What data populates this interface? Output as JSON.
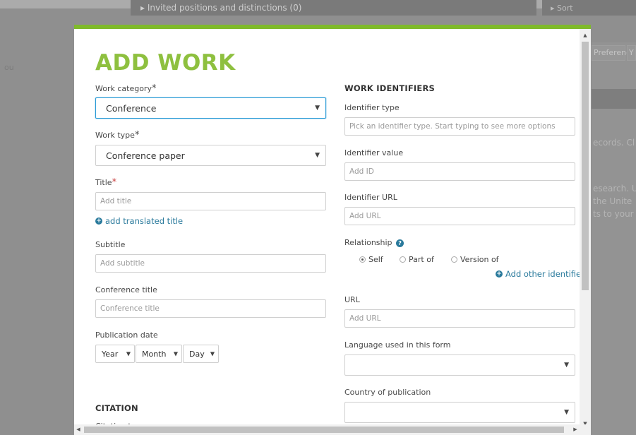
{
  "background": {
    "section_header": "▸ Invited positions and distinctions (0)",
    "sort_label": "▸ Sort",
    "you_text": "ou",
    "btn_text": "Preferences",
    "btn2_text": "Y",
    "text_lines": [
      "ecords. Cl",
      "esearch. U",
      "the Unite",
      "ts to your"
    ]
  },
  "modal": {
    "title": "ADD WORK",
    "work_category": {
      "label": "Work category",
      "value": "Conference"
    },
    "work_type": {
      "label": "Work type",
      "value": "Conference paper"
    },
    "title_field": {
      "label": "Title",
      "placeholder": "Add title"
    },
    "add_translated_title": "add translated title",
    "subtitle": {
      "label": "Subtitle",
      "placeholder": "Add subtitle"
    },
    "conference_title": {
      "label": "Conference title",
      "placeholder": "Conference title"
    },
    "publication_date": {
      "label": "Publication date",
      "year": "Year",
      "month": "Month",
      "day": "Day"
    },
    "citation_heading": "CITATION",
    "citation_type_label": "Citation type",
    "required_mark": "*",
    "identifiers": {
      "heading": "WORK IDENTIFIERS",
      "identifier_type": {
        "label": "Identifier type",
        "placeholder": "Pick an identifier type. Start typing to see more options"
      },
      "identifier_value": {
        "label": "Identifier value",
        "placeholder": "Add ID"
      },
      "identifier_url": {
        "label": "Identifier URL",
        "placeholder": "Add URL"
      },
      "relationship": {
        "label": "Relationship",
        "options": [
          "Self",
          "Part of",
          "Version of"
        ],
        "selected": "Self"
      },
      "add_other_identifier": "Add other identifier"
    },
    "url": {
      "label": "URL",
      "placeholder": "Add URL"
    },
    "language": {
      "label": "Language used in this form",
      "value": ""
    },
    "country": {
      "label": "Country of publication",
      "value": ""
    }
  },
  "colors": {
    "accent_green": "#8ec03f",
    "link_teal": "#2a7a9c",
    "focus_blue": "#2b9bd6",
    "required_red": "#c94242"
  },
  "icons": [
    "plus-circle-icon",
    "help-circle-icon",
    "caret-down-icon"
  ]
}
